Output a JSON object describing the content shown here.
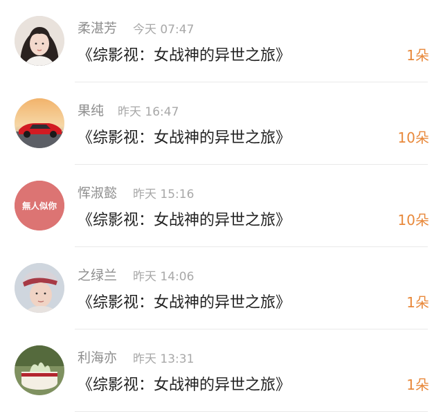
{
  "colors": {
    "name": "#8e8e8e",
    "time": "#a8a8a8",
    "title": "#222222",
    "count_accent": "#e8883a",
    "divider": "#e9e9e9"
  },
  "gifts": [
    {
      "user": "柔湛芳",
      "time": "今天 07:47",
      "work": "《综影视：女战神的异世之旅》",
      "count": "1朵",
      "avatar_icon": "girl-portrait-avatar"
    },
    {
      "user": "果纯",
      "time": "昨天 16:47",
      "work": "《综影视：女战神的异世之旅》",
      "count": "10朵",
      "avatar_icon": "red-car-sunset-avatar"
    },
    {
      "user": "恽淑懿",
      "time": "昨天 15:16",
      "work": "《综影视：女战神的异世之旅》",
      "count": "10朵",
      "avatar_icon": "text-badge-avatar",
      "avatar_text": "無人似你"
    },
    {
      "user": "之绿兰",
      "time": "昨天 14:06",
      "work": "《综影视：女战神的异世之旅》",
      "count": "1朵",
      "avatar_icon": "boy-portrait-avatar"
    },
    {
      "user": "利海亦",
      "time": "昨天 13:31",
      "work": "《综影视：女战神的异世之旅》",
      "count": "1朵",
      "avatar_icon": "cake-photo-avatar"
    }
  ]
}
